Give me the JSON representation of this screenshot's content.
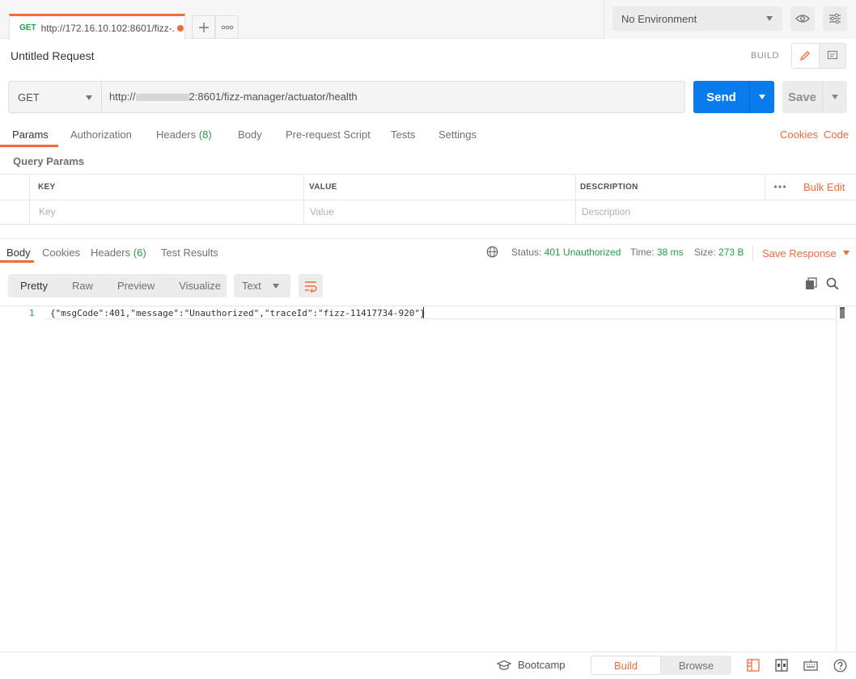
{
  "tab": {
    "method": "GET",
    "url": "http://172.16.10.102:8601/fizz-..."
  },
  "environment": {
    "selected": "No Environment"
  },
  "request": {
    "title": "Untitled Request",
    "mode_label": "BUILD",
    "method": "GET",
    "url_prefix": "http://",
    "url_suffix": "2:8601/fizz-manager/actuator/health",
    "send_label": "Send",
    "save_label": "Save"
  },
  "req_tabs": {
    "params": "Params",
    "authorization": "Authorization",
    "headers": "Headers",
    "headers_count": "(8)",
    "body": "Body",
    "prerequest": "Pre-request Script",
    "tests": "Tests",
    "settings": "Settings",
    "cookies": "Cookies",
    "code": "Code"
  },
  "query_params": {
    "title": "Query Params",
    "col_key": "KEY",
    "col_value": "VALUE",
    "col_description": "DESCRIPTION",
    "bulk_edit": "Bulk Edit",
    "ph_key": "Key",
    "ph_value": "Value",
    "ph_description": "Description"
  },
  "response": {
    "tabs": {
      "body": "Body",
      "cookies": "Cookies",
      "headers": "Headers",
      "headers_count": "(6)",
      "test_results": "Test Results"
    },
    "status_label": "Status:",
    "status_value": "401 Unauthorized",
    "time_label": "Time:",
    "time_value": "38 ms",
    "size_label": "Size:",
    "size_value": "273 B",
    "save_response": "Save Response",
    "views": {
      "pretty": "Pretty",
      "raw": "Raw",
      "preview": "Preview",
      "visualize": "Visualize"
    },
    "format": "Text",
    "line_number": "1",
    "body_text": "{\"msgCode\":401,\"message\":\"Unauthorized\",\"traceId\":\"fizz-11417734-920\"}"
  },
  "footer": {
    "bootcamp": "Bootcamp",
    "build": "Build",
    "browse": "Browse"
  },
  "colors": {
    "accent": "#f26b3a",
    "send": "#097bed",
    "success": "#249c47"
  }
}
